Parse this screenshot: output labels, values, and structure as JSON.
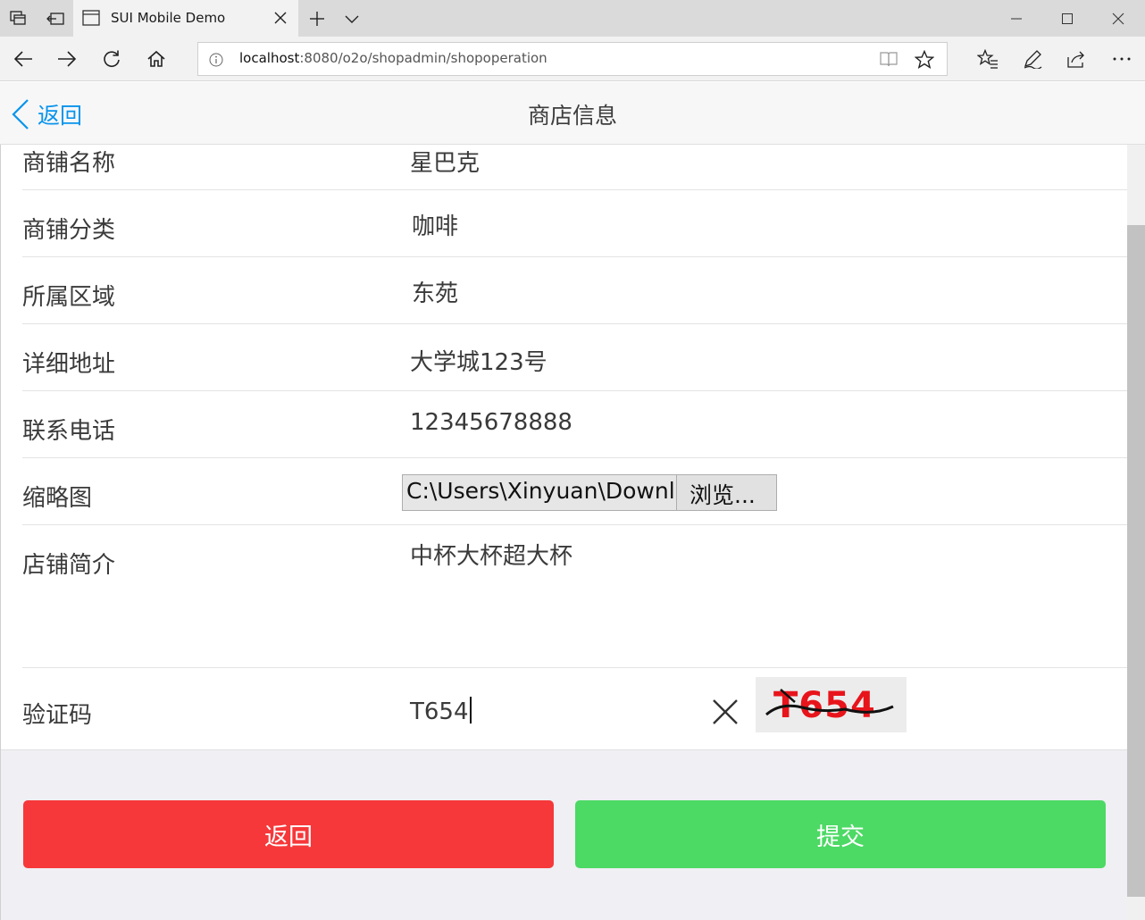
{
  "browser": {
    "tab_title": "SUI Mobile Demo",
    "url_host": "localhost",
    "url_rest": ":8080/o2o/shopadmin/shopoperation"
  },
  "header": {
    "back_label": "返回",
    "title": "商店信息"
  },
  "form": {
    "shop_name": {
      "label": "商铺名称",
      "value": "星巴克"
    },
    "category": {
      "label": "商铺分类",
      "value": "咖啡"
    },
    "area": {
      "label": "所属区域",
      "value": "东苑"
    },
    "address": {
      "label": "详细地址",
      "value": "大学城123号"
    },
    "phone": {
      "label": "联系电话",
      "value": "12345678888"
    },
    "thumbnail": {
      "label": "缩略图",
      "file_path": "C:\\Users\\Xinyuan\\Downlo",
      "browse_label": "浏览..."
    },
    "description": {
      "label": "店铺简介",
      "value": "中杯大杯超大杯"
    },
    "captcha": {
      "label": "验证码",
      "value": "T654",
      "image_text": "T654"
    }
  },
  "buttons": {
    "back": "返回",
    "submit": "提交"
  },
  "colors": {
    "accent": "#0894ec",
    "back_button": "#f6383a",
    "submit_button": "#4cd964",
    "captcha_text": "#e8141b"
  }
}
